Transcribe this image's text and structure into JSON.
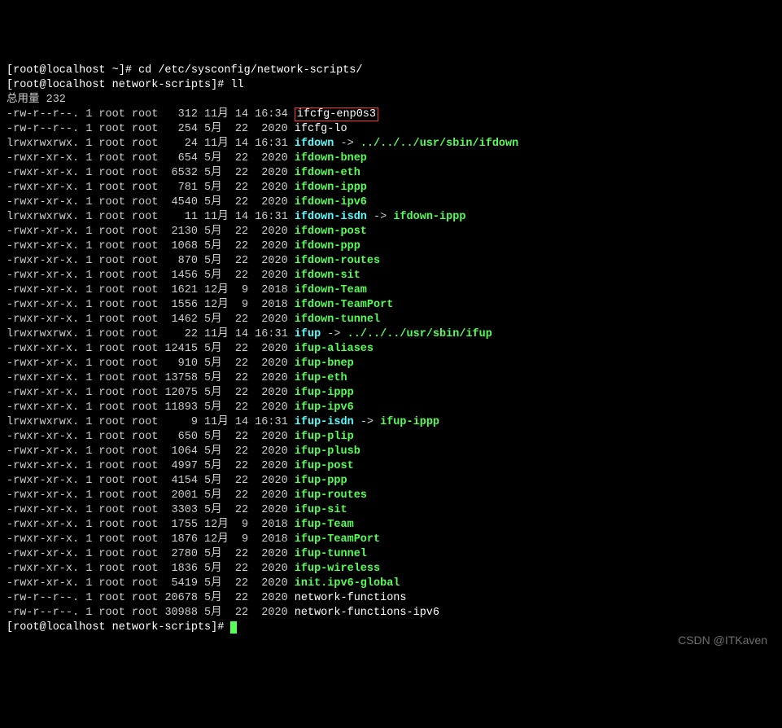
{
  "prompt1": {
    "user": "[root@localhost ~]# ",
    "cmd": "cd /etc/sysconfig/network-scripts/"
  },
  "prompt2": {
    "user": "[root@localhost network-scripts]# ",
    "cmd": "ll"
  },
  "total_line": "总用量 232",
  "files": [
    {
      "perm": "-rw-r--r--.",
      "links": "1",
      "owner": "root",
      "group": "root",
      "size": "312",
      "month": "11月",
      "day": "14",
      "time": "16:34",
      "name": "ifcfg-enp0s3",
      "type": "file",
      "highlight": true
    },
    {
      "perm": "-rw-r--r--.",
      "links": "1",
      "owner": "root",
      "group": "root",
      "size": "254",
      "month": "5月",
      "day": "22",
      "time": "2020",
      "name": "ifcfg-lo",
      "type": "file"
    },
    {
      "perm": "lrwxrwxrwx.",
      "links": "1",
      "owner": "root",
      "group": "root",
      "size": "24",
      "month": "11月",
      "day": "14",
      "time": "16:31",
      "name": "ifdown",
      "type": "link",
      "arrow": " -> ",
      "target": "../../../usr/sbin/ifdown"
    },
    {
      "perm": "-rwxr-xr-x.",
      "links": "1",
      "owner": "root",
      "group": "root",
      "size": "654",
      "month": "5月",
      "day": "22",
      "time": "2020",
      "name": "ifdown-bnep",
      "type": "exec"
    },
    {
      "perm": "-rwxr-xr-x.",
      "links": "1",
      "owner": "root",
      "group": "root",
      "size": "6532",
      "month": "5月",
      "day": "22",
      "time": "2020",
      "name": "ifdown-eth",
      "type": "exec"
    },
    {
      "perm": "-rwxr-xr-x.",
      "links": "1",
      "owner": "root",
      "group": "root",
      "size": "781",
      "month": "5月",
      "day": "22",
      "time": "2020",
      "name": "ifdown-ippp",
      "type": "exec"
    },
    {
      "perm": "-rwxr-xr-x.",
      "links": "1",
      "owner": "root",
      "group": "root",
      "size": "4540",
      "month": "5月",
      "day": "22",
      "time": "2020",
      "name": "ifdown-ipv6",
      "type": "exec"
    },
    {
      "perm": "lrwxrwxrwx.",
      "links": "1",
      "owner": "root",
      "group": "root",
      "size": "11",
      "month": "11月",
      "day": "14",
      "time": "16:31",
      "name": "ifdown-isdn",
      "type": "link",
      "arrow": " -> ",
      "target": "ifdown-ippp",
      "target_type": "exec"
    },
    {
      "perm": "-rwxr-xr-x.",
      "links": "1",
      "owner": "root",
      "group": "root",
      "size": "2130",
      "month": "5月",
      "day": "22",
      "time": "2020",
      "name": "ifdown-post",
      "type": "exec"
    },
    {
      "perm": "-rwxr-xr-x.",
      "links": "1",
      "owner": "root",
      "group": "root",
      "size": "1068",
      "month": "5月",
      "day": "22",
      "time": "2020",
      "name": "ifdown-ppp",
      "type": "exec"
    },
    {
      "perm": "-rwxr-xr-x.",
      "links": "1",
      "owner": "root",
      "group": "root",
      "size": "870",
      "month": "5月",
      "day": "22",
      "time": "2020",
      "name": "ifdown-routes",
      "type": "exec"
    },
    {
      "perm": "-rwxr-xr-x.",
      "links": "1",
      "owner": "root",
      "group": "root",
      "size": "1456",
      "month": "5月",
      "day": "22",
      "time": "2020",
      "name": "ifdown-sit",
      "type": "exec"
    },
    {
      "perm": "-rwxr-xr-x.",
      "links": "1",
      "owner": "root",
      "group": "root",
      "size": "1621",
      "month": "12月",
      "day": "9",
      "time": "2018",
      "name": "ifdown-Team",
      "type": "exec"
    },
    {
      "perm": "-rwxr-xr-x.",
      "links": "1",
      "owner": "root",
      "group": "root",
      "size": "1556",
      "month": "12月",
      "day": "9",
      "time": "2018",
      "name": "ifdown-TeamPort",
      "type": "exec"
    },
    {
      "perm": "-rwxr-xr-x.",
      "links": "1",
      "owner": "root",
      "group": "root",
      "size": "1462",
      "month": "5月",
      "day": "22",
      "time": "2020",
      "name": "ifdown-tunnel",
      "type": "exec"
    },
    {
      "perm": "lrwxrwxrwx.",
      "links": "1",
      "owner": "root",
      "group": "root",
      "size": "22",
      "month": "11月",
      "day": "14",
      "time": "16:31",
      "name": "ifup",
      "type": "link",
      "arrow": " -> ",
      "target": "../../../usr/sbin/ifup"
    },
    {
      "perm": "-rwxr-xr-x.",
      "links": "1",
      "owner": "root",
      "group": "root",
      "size": "12415",
      "month": "5月",
      "day": "22",
      "time": "2020",
      "name": "ifup-aliases",
      "type": "exec"
    },
    {
      "perm": "-rwxr-xr-x.",
      "links": "1",
      "owner": "root",
      "group": "root",
      "size": "910",
      "month": "5月",
      "day": "22",
      "time": "2020",
      "name": "ifup-bnep",
      "type": "exec"
    },
    {
      "perm": "-rwxr-xr-x.",
      "links": "1",
      "owner": "root",
      "group": "root",
      "size": "13758",
      "month": "5月",
      "day": "22",
      "time": "2020",
      "name": "ifup-eth",
      "type": "exec"
    },
    {
      "perm": "-rwxr-xr-x.",
      "links": "1",
      "owner": "root",
      "group": "root",
      "size": "12075",
      "month": "5月",
      "day": "22",
      "time": "2020",
      "name": "ifup-ippp",
      "type": "exec"
    },
    {
      "perm": "-rwxr-xr-x.",
      "links": "1",
      "owner": "root",
      "group": "root",
      "size": "11893",
      "month": "5月",
      "day": "22",
      "time": "2020",
      "name": "ifup-ipv6",
      "type": "exec"
    },
    {
      "perm": "lrwxrwxrwx.",
      "links": "1",
      "owner": "root",
      "group": "root",
      "size": "9",
      "month": "11月",
      "day": "14",
      "time": "16:31",
      "name": "ifup-isdn",
      "type": "link",
      "arrow": " -> ",
      "target": "ifup-ippp",
      "target_type": "exec"
    },
    {
      "perm": "-rwxr-xr-x.",
      "links": "1",
      "owner": "root",
      "group": "root",
      "size": "650",
      "month": "5月",
      "day": "22",
      "time": "2020",
      "name": "ifup-plip",
      "type": "exec"
    },
    {
      "perm": "-rwxr-xr-x.",
      "links": "1",
      "owner": "root",
      "group": "root",
      "size": "1064",
      "month": "5月",
      "day": "22",
      "time": "2020",
      "name": "ifup-plusb",
      "type": "exec"
    },
    {
      "perm": "-rwxr-xr-x.",
      "links": "1",
      "owner": "root",
      "group": "root",
      "size": "4997",
      "month": "5月",
      "day": "22",
      "time": "2020",
      "name": "ifup-post",
      "type": "exec"
    },
    {
      "perm": "-rwxr-xr-x.",
      "links": "1",
      "owner": "root",
      "group": "root",
      "size": "4154",
      "month": "5月",
      "day": "22",
      "time": "2020",
      "name": "ifup-ppp",
      "type": "exec"
    },
    {
      "perm": "-rwxr-xr-x.",
      "links": "1",
      "owner": "root",
      "group": "root",
      "size": "2001",
      "month": "5月",
      "day": "22",
      "time": "2020",
      "name": "ifup-routes",
      "type": "exec"
    },
    {
      "perm": "-rwxr-xr-x.",
      "links": "1",
      "owner": "root",
      "group": "root",
      "size": "3303",
      "month": "5月",
      "day": "22",
      "time": "2020",
      "name": "ifup-sit",
      "type": "exec"
    },
    {
      "perm": "-rwxr-xr-x.",
      "links": "1",
      "owner": "root",
      "group": "root",
      "size": "1755",
      "month": "12月",
      "day": "9",
      "time": "2018",
      "name": "ifup-Team",
      "type": "exec"
    },
    {
      "perm": "-rwxr-xr-x.",
      "links": "1",
      "owner": "root",
      "group": "root",
      "size": "1876",
      "month": "12月",
      "day": "9",
      "time": "2018",
      "name": "ifup-TeamPort",
      "type": "exec"
    },
    {
      "perm": "-rwxr-xr-x.",
      "links": "1",
      "owner": "root",
      "group": "root",
      "size": "2780",
      "month": "5月",
      "day": "22",
      "time": "2020",
      "name": "ifup-tunnel",
      "type": "exec"
    },
    {
      "perm": "-rwxr-xr-x.",
      "links": "1",
      "owner": "root",
      "group": "root",
      "size": "1836",
      "month": "5月",
      "day": "22",
      "time": "2020",
      "name": "ifup-wireless",
      "type": "exec"
    },
    {
      "perm": "-rwxr-xr-x.",
      "links": "1",
      "owner": "root",
      "group": "root",
      "size": "5419",
      "month": "5月",
      "day": "22",
      "time": "2020",
      "name": "init.ipv6-global",
      "type": "exec"
    },
    {
      "perm": "-rw-r--r--.",
      "links": "1",
      "owner": "root",
      "group": "root",
      "size": "20678",
      "month": "5月",
      "day": "22",
      "time": "2020",
      "name": "network-functions",
      "type": "file"
    },
    {
      "perm": "-rw-r--r--.",
      "links": "1",
      "owner": "root",
      "group": "root",
      "size": "30988",
      "month": "5月",
      "day": "22",
      "time": "2020",
      "name": "network-functions-ipv6",
      "type": "file"
    }
  ],
  "prompt3": {
    "user": "[root@localhost network-scripts]# "
  },
  "watermark": "CSDN @ITKaven"
}
